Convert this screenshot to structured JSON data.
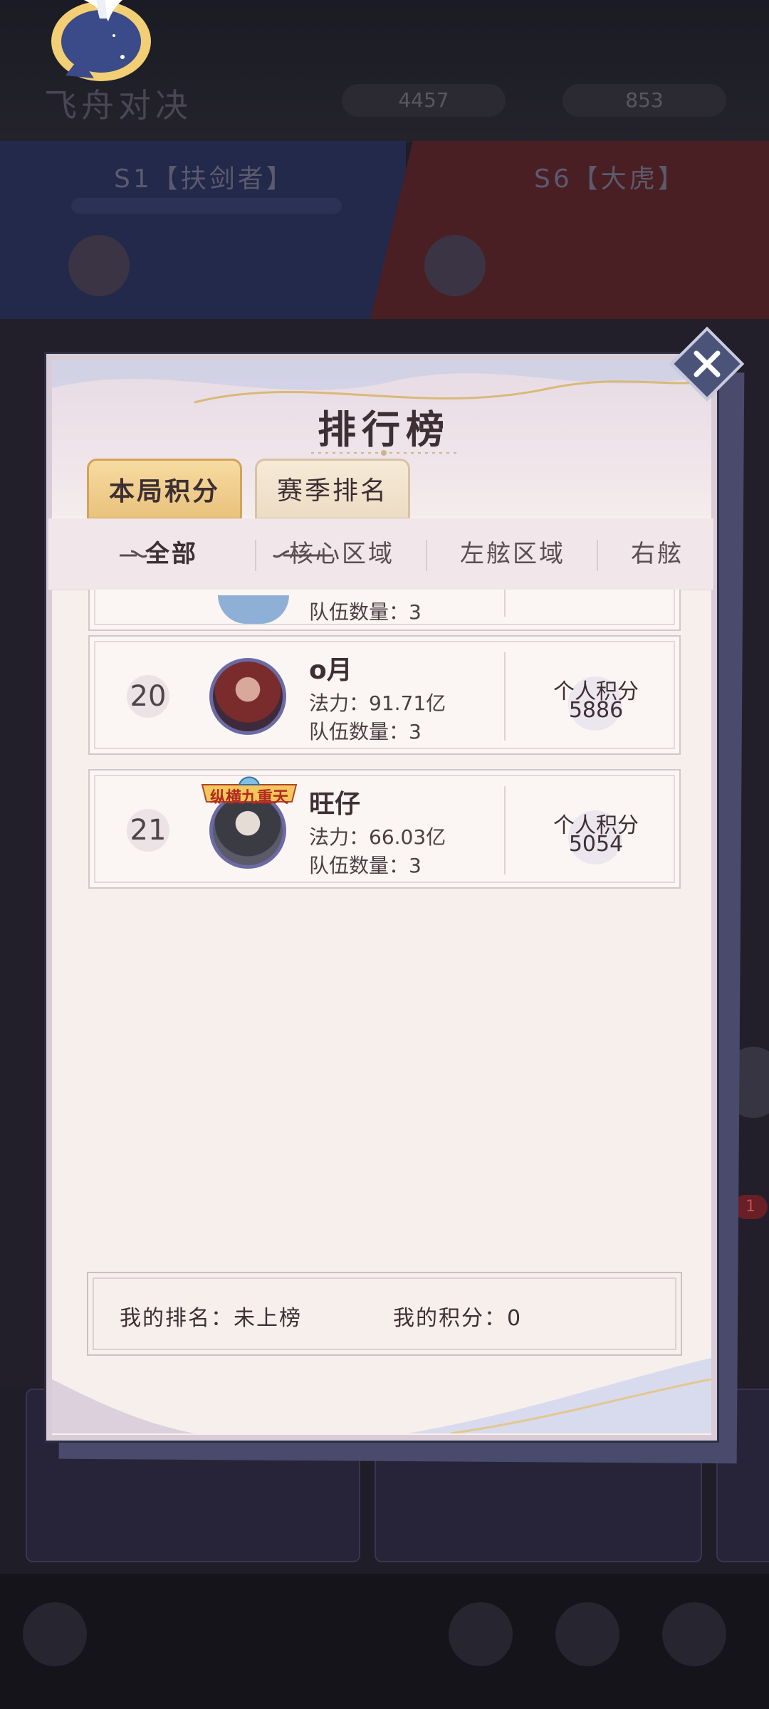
{
  "background": {
    "title": "飞舟对决",
    "resource_1": "4457",
    "resource_2": "853",
    "team_left_name": "S1【扶剑者】",
    "team_right_name": "S6【大虎】"
  },
  "modal": {
    "title": "排行榜",
    "close_icon": "close-icon",
    "tabs": [
      {
        "label": "本局积分",
        "active": true
      },
      {
        "label": "赛季排名",
        "active": false
      }
    ],
    "subtabs": [
      {
        "label": "全部",
        "active": true
      },
      {
        "label": "核心区域",
        "active": false
      },
      {
        "label": "左舷区域",
        "active": false
      },
      {
        "label": "右舷",
        "active": false
      }
    ],
    "partial_row": {
      "team_count": "队伍数量：3"
    },
    "rows": [
      {
        "rank": "20",
        "name": "o月",
        "power": "法力：91.71亿",
        "team_count": "队伍数量：3",
        "score_label": "个人积分",
        "score": "5886"
      },
      {
        "rank": "21",
        "name": "旺仔",
        "power": "法力：66.03亿",
        "team_count": "队伍数量：3",
        "score_label": "个人积分",
        "score": "5054",
        "avatar_badge": "纵横九重天"
      }
    ],
    "my_rank_label": "我的排名：未上榜",
    "my_score_label": "我的积分：0"
  },
  "colors": {
    "modal_bg": "#f7efec",
    "tab_active": "#e9c27d",
    "frame": "#2b2d45",
    "text": "#3d2f34"
  }
}
